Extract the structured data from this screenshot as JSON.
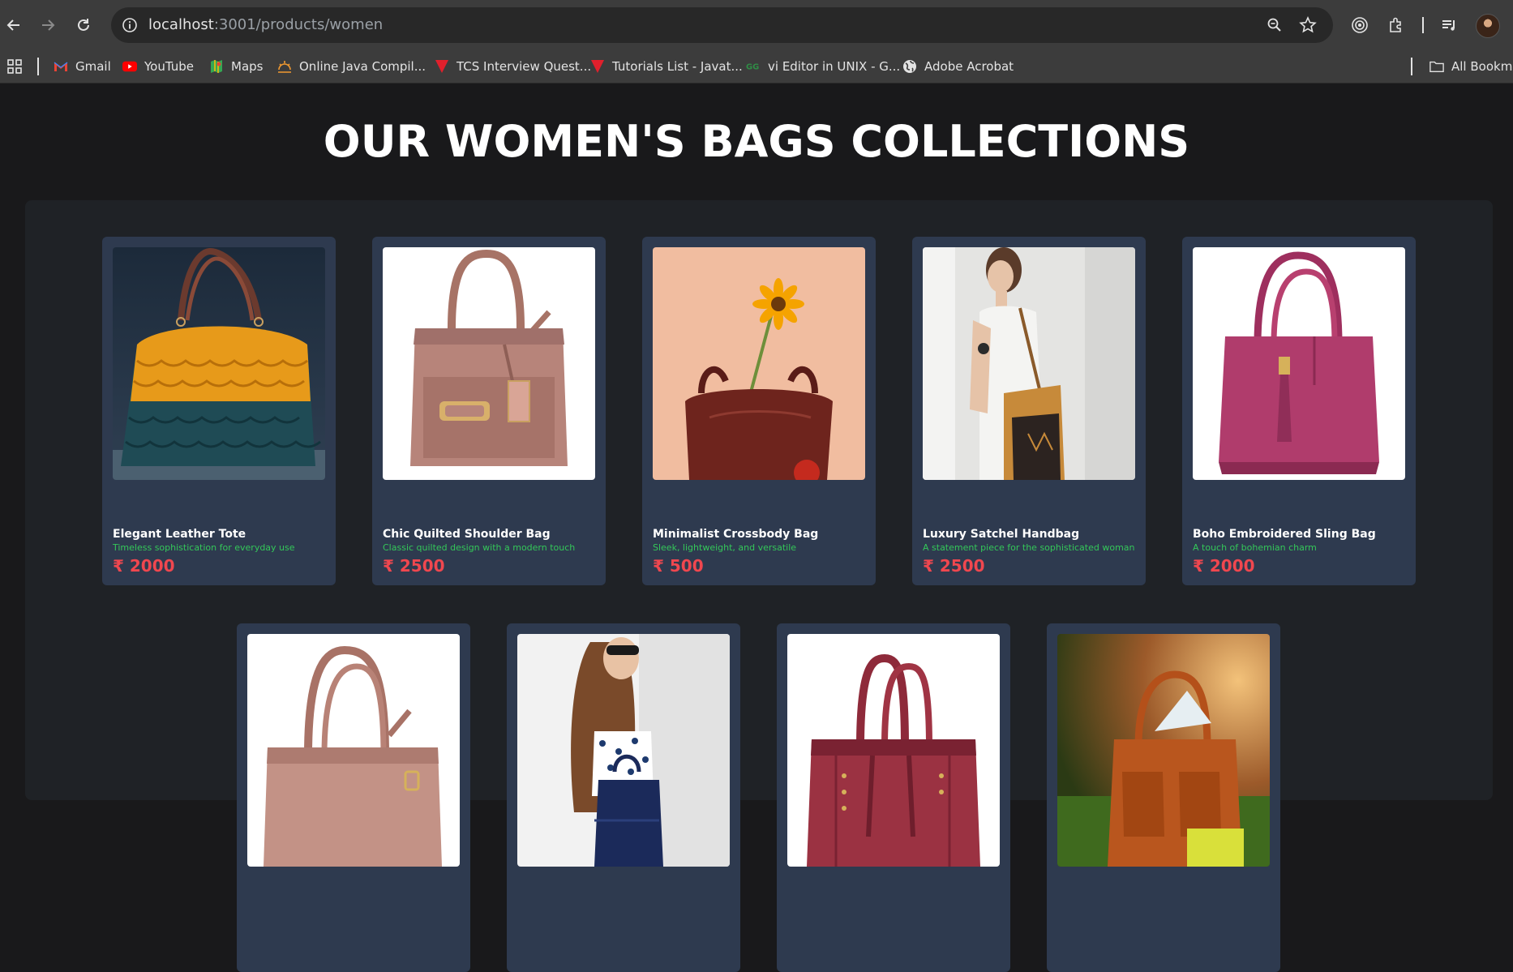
{
  "browser": {
    "url_host": "localhost",
    "url_rest": ":3001/products/women",
    "bookmarks": [
      {
        "label": "Gmail",
        "icon": "gmail-icon"
      },
      {
        "label": "YouTube",
        "icon": "youtube-icon"
      },
      {
        "label": "Maps",
        "icon": "maps-icon"
      },
      {
        "label": "Online Java Compil...",
        "icon": "compiler-icon"
      },
      {
        "label": "TCS Interview Quest...",
        "icon": "tcs-icon"
      },
      {
        "label": "Tutorials List - Javat...",
        "icon": "javatpoint-icon"
      },
      {
        "label": "vi Editor in UNIX - G...",
        "icon": "gfg-icon"
      },
      {
        "label": "Adobe Acrobat",
        "icon": "globe-icon"
      }
    ],
    "all_bookmarks_label": "All Bookmarks"
  },
  "page": {
    "title": "OUR WOMEN'S BAGS COLLECTIONS"
  },
  "products": [
    {
      "name": "Elegant Leather Tote",
      "desc": "Timeless sophistication for everyday use",
      "price": "₹ 2000"
    },
    {
      "name": "Chic Quilted Shoulder Bag",
      "desc": "Classic quilted design with a modern touch",
      "price": "₹ 2500"
    },
    {
      "name": "Minimalist Crossbody Bag",
      "desc": "Sleek, lightweight, and versatile",
      "price": "₹ 500"
    },
    {
      "name": "Luxury Satchel Handbag",
      "desc": "A statement piece for the sophisticated woman",
      "price": "₹ 2500"
    },
    {
      "name": "Boho Embroidered Sling Bag",
      "desc": "A touch of bohemian charm",
      "price": "₹ 2000"
    },
    {
      "name": "",
      "desc": "",
      "price": ""
    },
    {
      "name": "",
      "desc": "",
      "price": ""
    },
    {
      "name": "",
      "desc": "",
      "price": ""
    },
    {
      "name": "",
      "desc": "",
      "price": ""
    }
  ],
  "colors": {
    "card_bg": "#2e3a4f",
    "desc_green": "#34c759",
    "price_red": "#f0474f"
  }
}
